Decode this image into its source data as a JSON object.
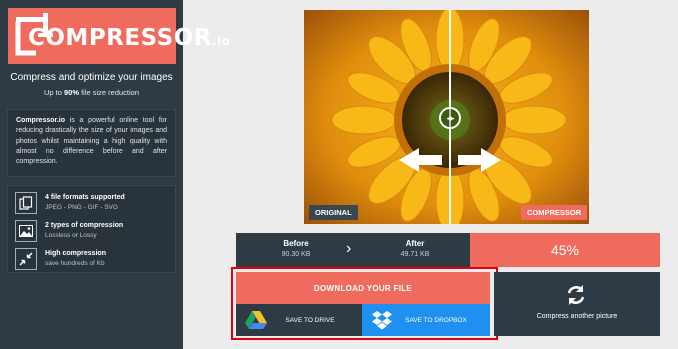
{
  "brand": {
    "name": "COMPRESSOR",
    "suffix": ".io",
    "accent": "#ee6b5e",
    "sidebar_bg": "#2f3b44"
  },
  "tagline": "Compress and optimize your images",
  "subline": {
    "prefix": "Up to ",
    "highlight": "90%",
    "suffix": " file size reduction"
  },
  "about": {
    "name": "Compressor.io",
    "text": " is a powerful online tool for reducing drastically the size of your images and photos whilst maintaining a high quality with almost no difference before and after compression."
  },
  "features": [
    {
      "icon": "files-icon",
      "title": "4 file formats supported",
      "subtitle": "JPEG - PNG - GIF - SVG"
    },
    {
      "icon": "image-icon",
      "title": "2 types of compression",
      "subtitle": "Lossless or Lossy"
    },
    {
      "icon": "compress-arrows-icon",
      "title": "High compression",
      "subtitle": "save hundreds of Kb"
    }
  ],
  "comparison": {
    "left_label": "ORIGINAL",
    "right_label": "COMPRESSOR",
    "handle_icon": "slider-handle-icon"
  },
  "stats": {
    "before_label": "Before",
    "before_value": "90.30 KB",
    "after_label": "After",
    "after_value": "49.71 KB",
    "savings": "45%"
  },
  "actions": {
    "download": "DOWNLOAD YOUR FILE",
    "drive": "SAVE TO DRIVE",
    "dropbox": "SAVE TO DROPBOX",
    "another": "Compress another picture"
  }
}
